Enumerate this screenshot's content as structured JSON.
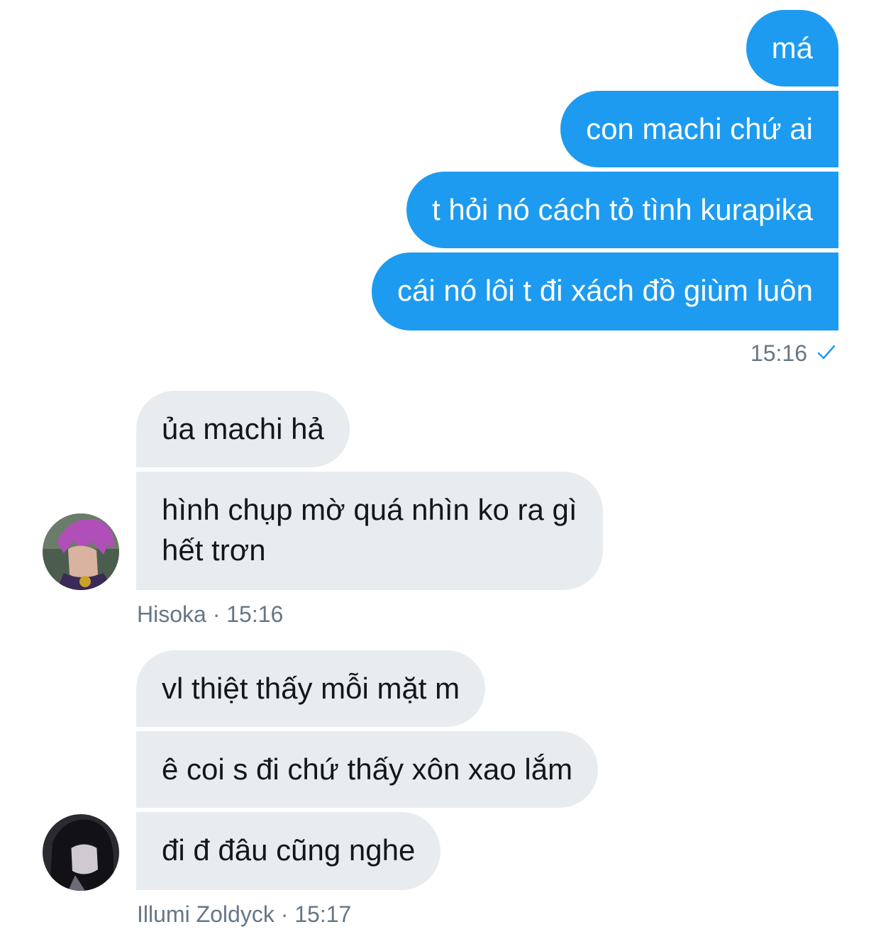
{
  "outgoing": {
    "messages": [
      "má",
      "con machi chứ ai",
      "t hỏi nó cách tỏ tình kurapika",
      "cái nó lôi t đi xách đồ giùm luôn"
    ],
    "time": "15:16",
    "status_icon": "check-icon"
  },
  "hisoka": {
    "messages": [
      "ủa machi hả",
      "hình chụp mờ quá nhìn ko ra gì\nhết trơn"
    ],
    "sender": "Hisoka",
    "separator": "·",
    "time": "15:16"
  },
  "illumi": {
    "messages": [
      "vl thiệt thấy mỗi mặt m",
      "ê coi s đi chứ thấy xôn xao lắm",
      "đi đ đâu cũng nghe"
    ],
    "sender": "Illumi Zoldyck",
    "separator": "·",
    "time": "15:17"
  },
  "colors": {
    "outgoing_bubble": "#1d9bf0",
    "incoming_bubble": "#e9ecef",
    "meta_text": "#657786"
  }
}
